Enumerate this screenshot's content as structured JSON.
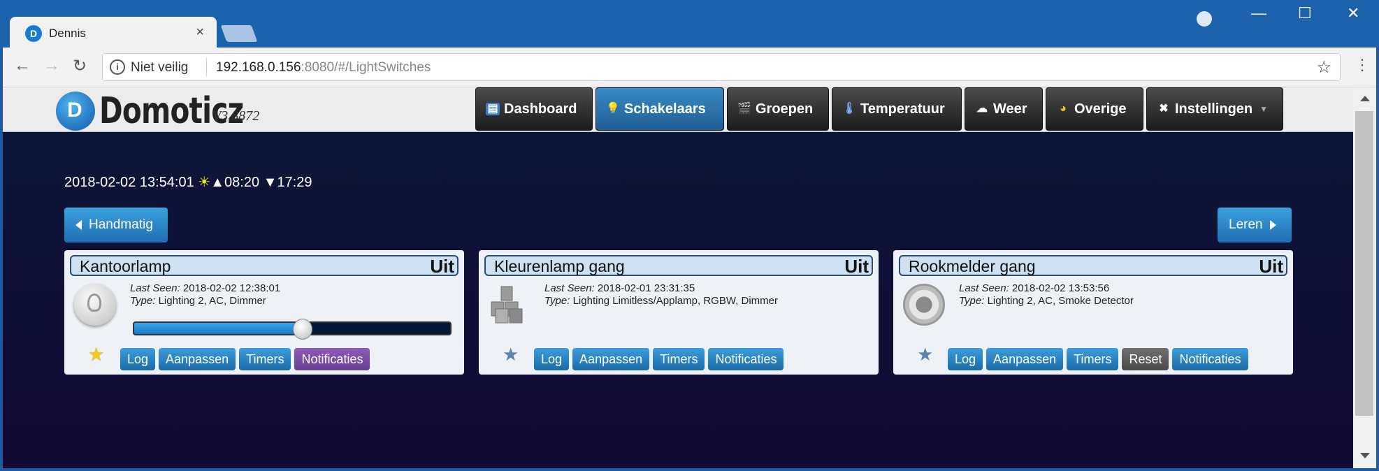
{
  "browser": {
    "tab_title": "Dennis",
    "tab_close": "×",
    "security_label": "Niet veilig",
    "url_host": "192.168.0.156",
    "url_rest": ":8080/#/LightSwitches",
    "back_glyph": "←",
    "forward_glyph": "→",
    "reload_glyph": "↻",
    "bookmark_glyph": "☆",
    "menu_glyph": "⋮",
    "minimize_glyph": "—",
    "maximize_glyph": "☐",
    "close_glyph": "✕"
  },
  "app": {
    "logo_letter": "D",
    "logo_text": "Domoticz",
    "version": "V3.8872"
  },
  "nav": [
    {
      "label": "Dashboard",
      "icon": "dashboard-icon",
      "glyph": "▤",
      "active": false
    },
    {
      "label": "Schakelaars",
      "icon": "lightbulb-icon",
      "glyph": "💡",
      "active": true
    },
    {
      "label": "Groepen",
      "icon": "clapper-icon",
      "glyph": "🎬",
      "active": false
    },
    {
      "label": "Temperatuur",
      "icon": "thermometer-icon",
      "glyph": "🌡",
      "active": false
    },
    {
      "label": "Weer",
      "icon": "rain-cloud-icon",
      "glyph": "☁",
      "active": false
    },
    {
      "label": "Overige",
      "icon": "utility-icon",
      "glyph": "◕",
      "active": false
    },
    {
      "label": "Instellingen",
      "icon": "tools-icon",
      "glyph": "✖",
      "active": false,
      "dropdown": true
    }
  ],
  "clock": {
    "datetime": "2018-02-02 13:54:01",
    "sun_glyph": "☀",
    "sunrise": "▲08:20",
    "sunset": "▼17:29"
  },
  "buttons": {
    "manual": "Handmatig",
    "learn": "Leren"
  },
  "devices": [
    {
      "name": "Kantoorlamp",
      "status": "Uit",
      "last_seen_label": "Last Seen:",
      "last_seen": "2018-02-02 12:38:01",
      "type_label": "Type:",
      "type": "Lighting 2, AC, Dimmer",
      "icon": "lightbulb-icon",
      "favorite": true,
      "dimmer_level": 0.53,
      "actions": [
        "Log",
        "Aanpassen",
        "Timers",
        "Notificaties"
      ]
    },
    {
      "name": "Kleurenlamp gang",
      "status": "Uit",
      "last_seen_label": "Last Seen:",
      "last_seen": "2018-02-01 23:31:35",
      "type_label": "Type:",
      "type": "Lighting Limitless/Applamp, RGBW, Dimmer",
      "icon": "cubes-icon",
      "favorite": false,
      "actions": [
        "Log",
        "Aanpassen",
        "Timers",
        "Notificaties"
      ]
    },
    {
      "name": "Rookmelder gang",
      "status": "Uit",
      "last_seen_label": "Last Seen:",
      "last_seen": "2018-02-02 13:53:56",
      "type_label": "Type:",
      "type": "Lighting 2, AC, Smoke Detector",
      "icon": "smoke-detector-icon",
      "favorite": false,
      "actions": [
        "Log",
        "Aanpassen",
        "Timers",
        "Reset",
        "Notificaties"
      ]
    }
  ],
  "colors": {
    "accent": "#1f6fb2",
    "active_nav": "#2a78b5",
    "notify_purple": "#7a4aa8",
    "reset_gray": "#5a5a5a",
    "page_bg": "#0d1639"
  }
}
